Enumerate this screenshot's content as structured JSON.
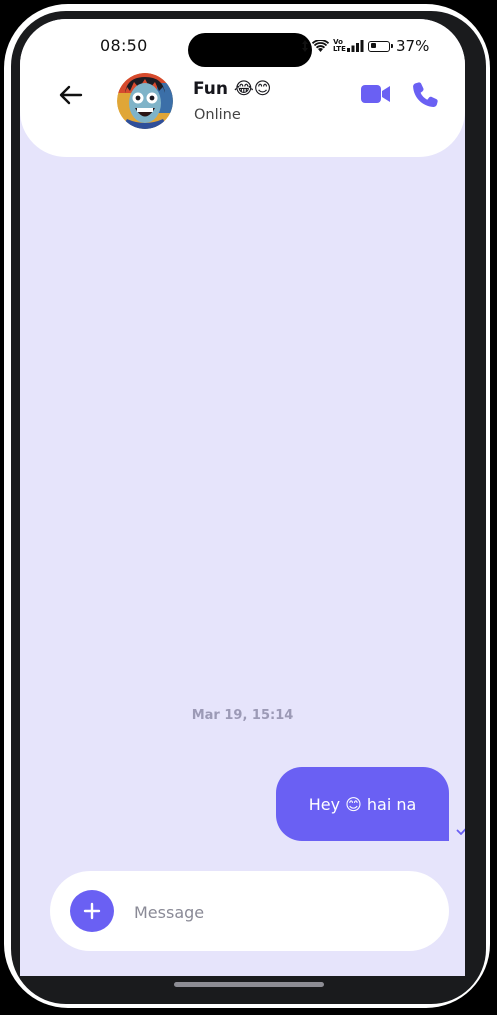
{
  "status_bar": {
    "time": "08:50",
    "lte_label": "Vo LTE",
    "battery_percent": "37%",
    "battery_level": 0.37
  },
  "header": {
    "back_icon": "arrow-left-icon",
    "contact_name": "Fun 😂😊",
    "contact_status": "Online",
    "video_icon": "video-camera-icon",
    "call_icon": "phone-icon"
  },
  "chat": {
    "date_separator": "Mar 19, 15:14",
    "messages": [
      {
        "text": "Hey 😊 hai na",
        "direction": "outgoing",
        "status": "sent"
      }
    ]
  },
  "composer": {
    "add_icon": "plus-icon",
    "placeholder": "Message",
    "value": ""
  },
  "colors": {
    "accent": "#6a60f3",
    "chat_background": "#e6e4fb",
    "header_background": "#ffffff"
  }
}
